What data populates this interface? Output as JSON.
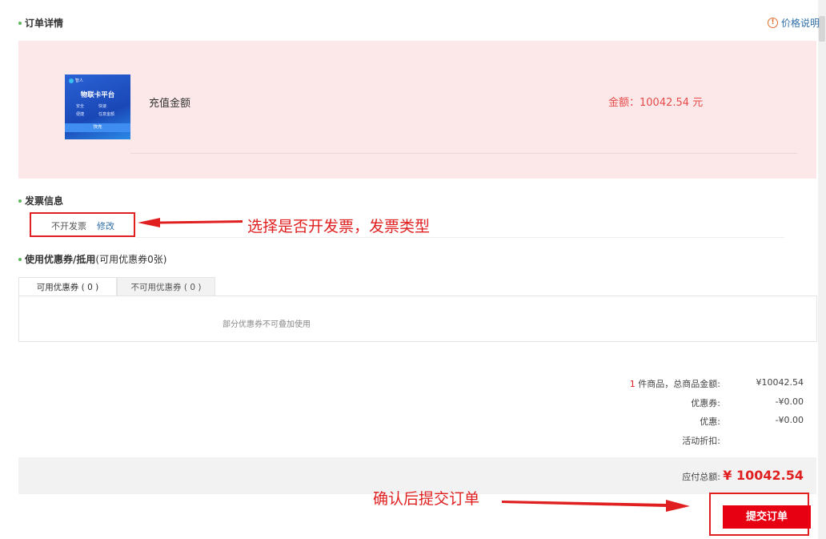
{
  "order_details": {
    "title": "订单详情",
    "price_info_link": "价格说明",
    "product": {
      "image": {
        "brand": "智人",
        "title": "物联卡平台",
        "features": [
          "安全",
          "快速",
          "便捷",
          "任意金额"
        ],
        "button": "快充"
      },
      "name": "充值金额",
      "amount_label": "金额：",
      "amount_value": "10042.54",
      "amount_unit": "元"
    }
  },
  "invoice": {
    "title": "发票信息",
    "status": "不开发票",
    "edit_label": "修改",
    "annotation": "选择是否开发票，发票类型"
  },
  "coupons": {
    "title": "使用优惠券/抵用",
    "subtitle": "(可用优惠券0张)",
    "tabs": [
      {
        "label": "可用优惠券 ( 0 )",
        "active": true
      },
      {
        "label": "不可用优惠券 ( 0 )",
        "active": false
      }
    ],
    "note": "部分优惠券不可叠加使用"
  },
  "summary": {
    "item_count": "1",
    "items_label": "件商品，总商品金额:",
    "items_total": "¥10042.54",
    "coupon_label": "优惠券:",
    "coupon_value": "-¥0.00",
    "discount_label": "优惠:",
    "discount_value": "-¥0.00",
    "activity_label": "活动折扣:",
    "activity_value": "",
    "payable_label": "应付总额:",
    "payable_value": "¥ 10042.54"
  },
  "submit": {
    "annotation": "确认后提交订单",
    "button_label": "提交订单"
  },
  "colors": {
    "accent_red": "#e60012",
    "order_bg": "#fde8e9",
    "link_blue": "#2f6ea8",
    "dot_green": "#5cb85c"
  }
}
